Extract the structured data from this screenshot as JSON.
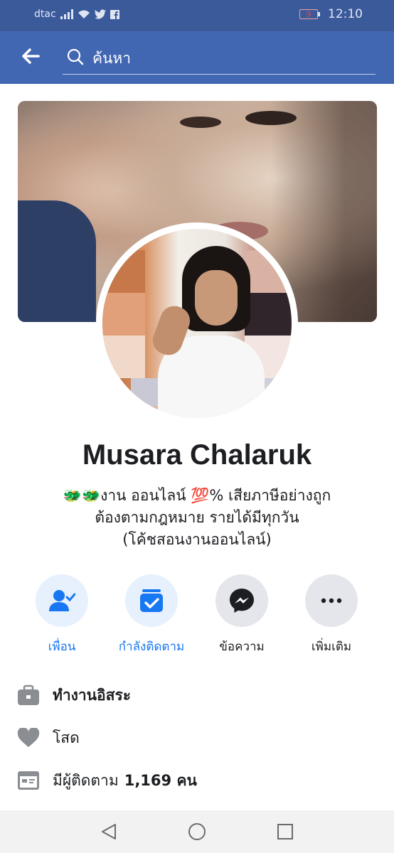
{
  "status_bar": {
    "carrier": "dtac",
    "battery": "9",
    "time": "12:10",
    "icons": [
      "signal-icon",
      "wifi-icon",
      "twitter-icon",
      "facebook-icon"
    ]
  },
  "app_bar": {
    "back_icon": "arrow-left-icon",
    "search_icon": "search-icon",
    "search_text": "ค้นหา"
  },
  "profile": {
    "name": "Musara Chalaruk",
    "bio_line1": "🐲🐲งาน ออนไลน์ 💯% เสียภาษีอย่างถูก",
    "bio_line2": "ต้องตามกฎหมาย รายได้มีทุกวัน",
    "bio_line3": "(โค้ชสอนงานออนไลน์)"
  },
  "actions": [
    {
      "label": "เพื่อน",
      "icon": "friend-check-icon",
      "accent": "#1877f2"
    },
    {
      "label": "กำลังติดตาม",
      "icon": "following-check-icon",
      "accent": "#1877f2"
    },
    {
      "label": "ข้อความ",
      "icon": "messenger-icon",
      "accent": "#1c1e21"
    },
    {
      "label": "เพิ่มเติม",
      "icon": "more-icon",
      "accent": "#1c1e21"
    }
  ],
  "info": {
    "work": "ทำงานอิสระ",
    "relationship": "โสด",
    "followers_prefix": "มีผู้ติดตาม",
    "followers_count": "1,169 คน"
  },
  "nav": [
    "back-triangle-icon",
    "home-circle-icon",
    "recents-square-icon"
  ],
  "colors": {
    "status_bar": "#3b5a9a",
    "app_bar": "#4267b2",
    "accent": "#1877f2"
  }
}
